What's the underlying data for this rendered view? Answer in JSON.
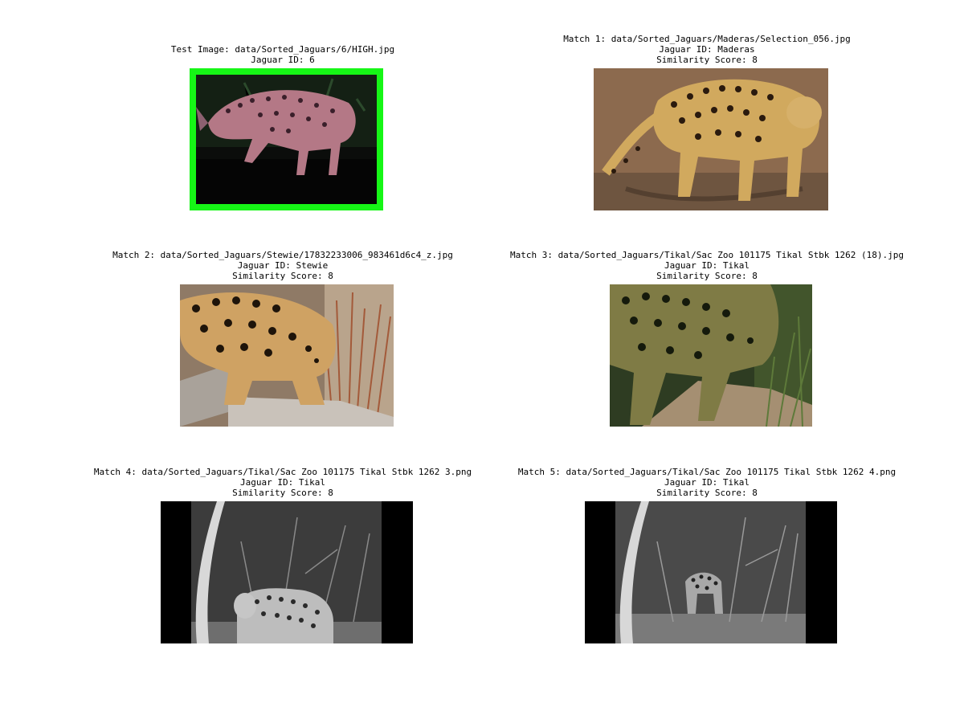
{
  "panels": [
    {
      "caption": [
        "Test Image: data/Sorted_Jaguars/6/HIGH.jpg",
        "Jaguar ID: 6"
      ],
      "image": "pink-tinted jaguar walking on dark log",
      "border_color": "#16f616"
    },
    {
      "caption": [
        "Match 1: data/Sorted_Jaguars/Maderas/Selection_056.jpg",
        "Jaguar ID: Maderas",
        "Similarity Score: 8"
      ],
      "image": "jaguar standing on dirt ground"
    },
    {
      "caption": [
        "Match 2: data/Sorted_Jaguars/Stewie/17832233006_983461d6c4_z.jpg",
        "Jaguar ID: Stewie",
        "Similarity Score: 8"
      ],
      "image": "jaguar stalking over rocks near reeds"
    },
    {
      "caption": [
        "Match 3: data/Sorted_Jaguars/Tikal/Sac Zoo 101175 Tikal Stbk 1262 (18).jpg",
        "Jaguar ID: Tikal",
        "Similarity Score: 8"
      ],
      "image": "jaguar walking through green foliage"
    },
    {
      "caption": [
        "Match 4: data/Sorted_Jaguars/Tikal/Sac Zoo 101175 Tikal Stbk 1262 3.png",
        "Jaguar ID: Tikal",
        "Similarity Score: 8"
      ],
      "image": "night camera trap grayscale jaguar crouching"
    },
    {
      "caption": [
        "Match 5: data/Sorted_Jaguars/Tikal/Sac Zoo 101175 Tikal Stbk 1262 4.png",
        "Jaguar ID: Tikal",
        "Similarity Score: 8"
      ],
      "image": "night camera trap grayscale jaguar in foliage"
    }
  ]
}
